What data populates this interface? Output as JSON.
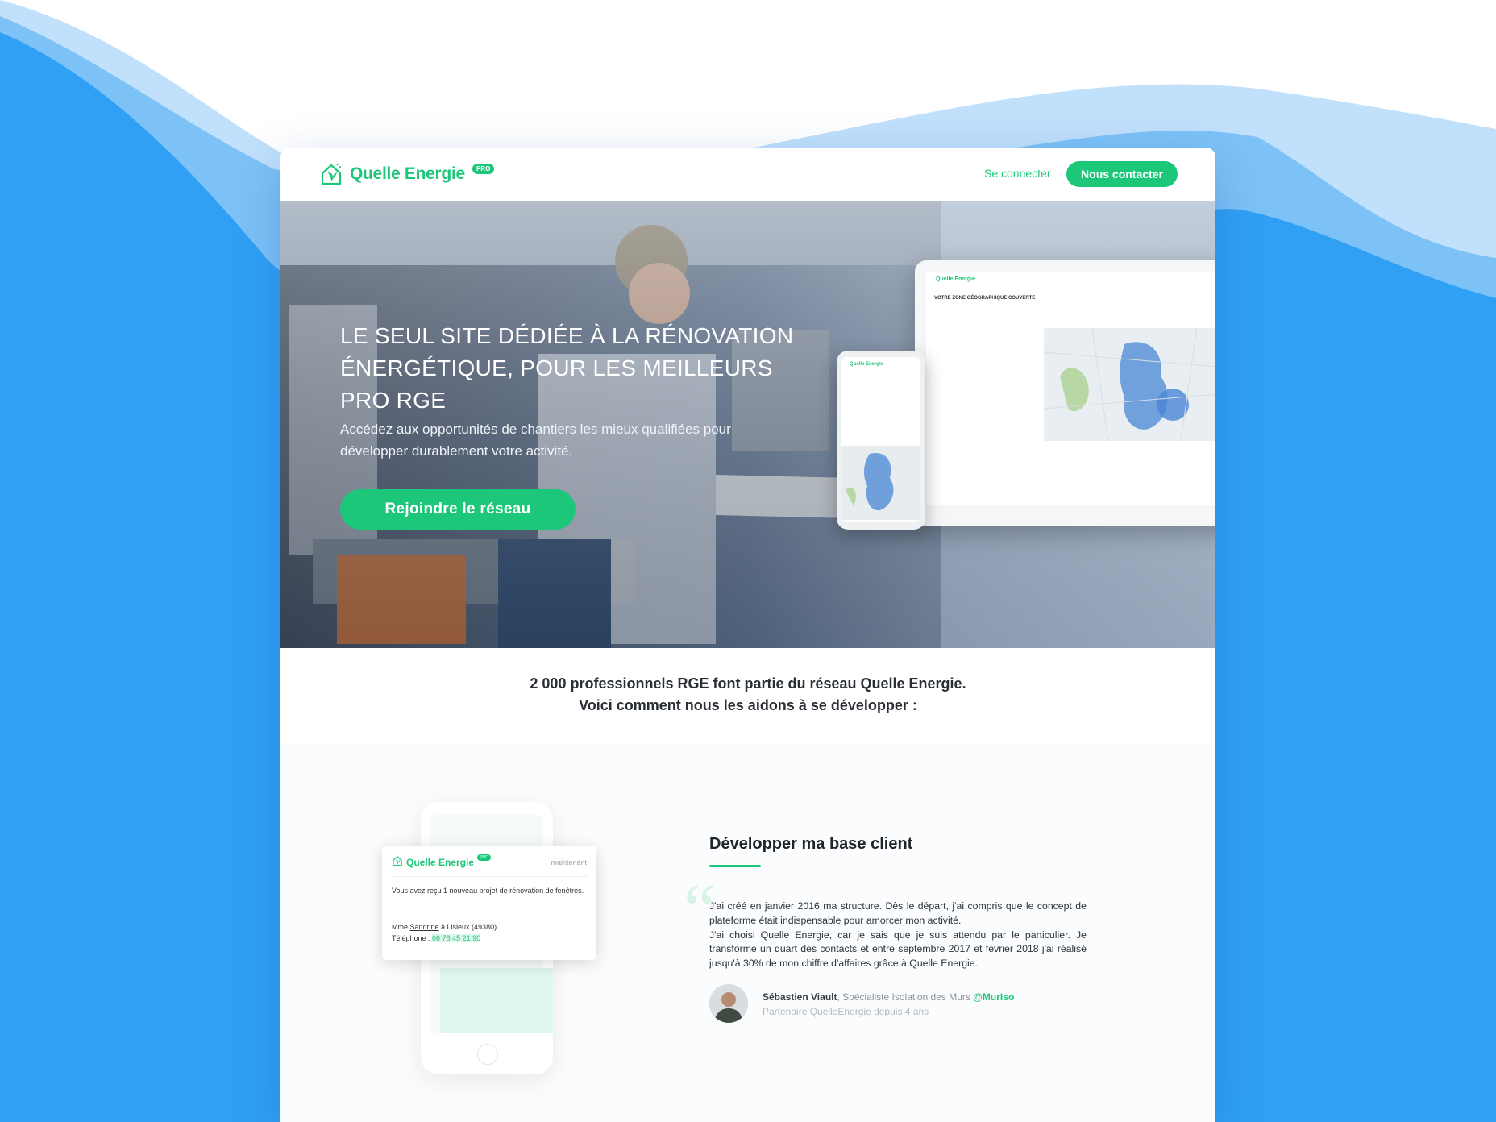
{
  "colors": {
    "brand_green": "#1dc77a",
    "background_blue": "#30a0f5",
    "text_dark": "#2a2f36"
  },
  "header": {
    "logo_text": "Quelle Energie",
    "logo_badge": "PRO",
    "login_link": "Se connecter",
    "contact_button": "Nous contacter"
  },
  "hero": {
    "title": "LE SEUL SITE DÉDIÉE À LA RÉNOVATION ÉNERGÉTIQUE, POUR LES MEILLEURS PRO RGE",
    "subtitle": "Accédez aux opportunités de chantiers les mieux qualifiées pour développer durablement votre activité.",
    "cta_button": "Rejoindre le réseau",
    "tablet": {
      "logo": "Quelle Energie",
      "section_title": "VOTRE ZONE GÉOGRAPHIQUE COUVERTE"
    },
    "phone": {
      "logo": "Quelle Energie"
    }
  },
  "intro": {
    "line1": "2 000 professionnels RGE font partie du réseau Quelle Energie.",
    "line2": "Voici comment nous les aidons à se développer :"
  },
  "feature": {
    "title": "Développer ma base client",
    "quote_p1": "J'ai créé en janvier 2016 ma structure. Dès le départ, j'ai compris que le concept de plateforme était indispensable pour amorcer mon activité.",
    "quote_p2": "J'ai choisi Quelle Energie, car je sais que je suis attendu par le particulier. Je transforme un quart des contacts et entre septembre 2017 et février 2018 j'ai réalisé jusqu'à 30% de mon chiffre d'affaires grâce à Quelle Energie.",
    "author_name": "Sébastien Viault",
    "author_role": ", Spécialiste Isolation des Murs ",
    "author_handle": "@MurIso",
    "author_since": "Partenaire QuelleEnergie depuis 4 ans"
  },
  "notification": {
    "logo": "Quelle Energie",
    "badge": "PRO",
    "time": "maintenant",
    "message": "Vous avez reçu 1 nouveau projet de rénovation de fenêtres.",
    "client_prefix": "Mme ",
    "client_name": "Sandrine",
    "client_suffix": " à Lisieux (49380)",
    "phone_label": "Téléphone : ",
    "phone_value": "06 78 45 21 90"
  }
}
